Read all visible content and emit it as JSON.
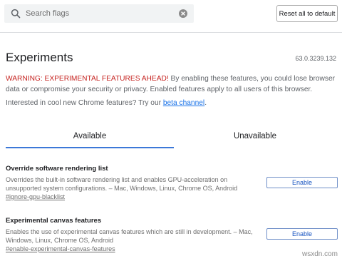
{
  "header": {
    "search_placeholder": "Search flags",
    "reset_label": "Reset all to default"
  },
  "page": {
    "title": "Experiments",
    "version": "63.0.3239.132"
  },
  "warning": {
    "strong": "WARNING: EXPERIMENTAL FEATURES AHEAD!",
    "text": " By enabling these features, you could lose browser data or compromise your security or privacy. Enabled features apply to all users of this browser."
  },
  "beta": {
    "prefix": "Interested in cool new Chrome features? Try our ",
    "link": "beta channel",
    "suffix": "."
  },
  "tabs": [
    {
      "label": "Available",
      "active": true
    },
    {
      "label": "Unavailable",
      "active": false
    }
  ],
  "experiments": [
    {
      "name": "Override software rendering list",
      "description": "Overrides the built-in software rendering list and enables GPU-acceleration on unsupported system configurations. – Mac, Windows, Linux, Chrome OS, Android",
      "link": "#ignore-gpu-blacklist",
      "button": "Enable"
    },
    {
      "name": "Experimental canvas features",
      "description": "Enables the use of experimental canvas features which are still in development. – Mac, Windows, Linux, Chrome OS, Android",
      "link": "#enable-experimental-canvas-features",
      "button": "Enable"
    }
  ],
  "watermark": "wsxdn.com",
  "colors": {
    "accent": "#3c78d8",
    "warning": "#c5221f",
    "link": "#1a73e8"
  }
}
